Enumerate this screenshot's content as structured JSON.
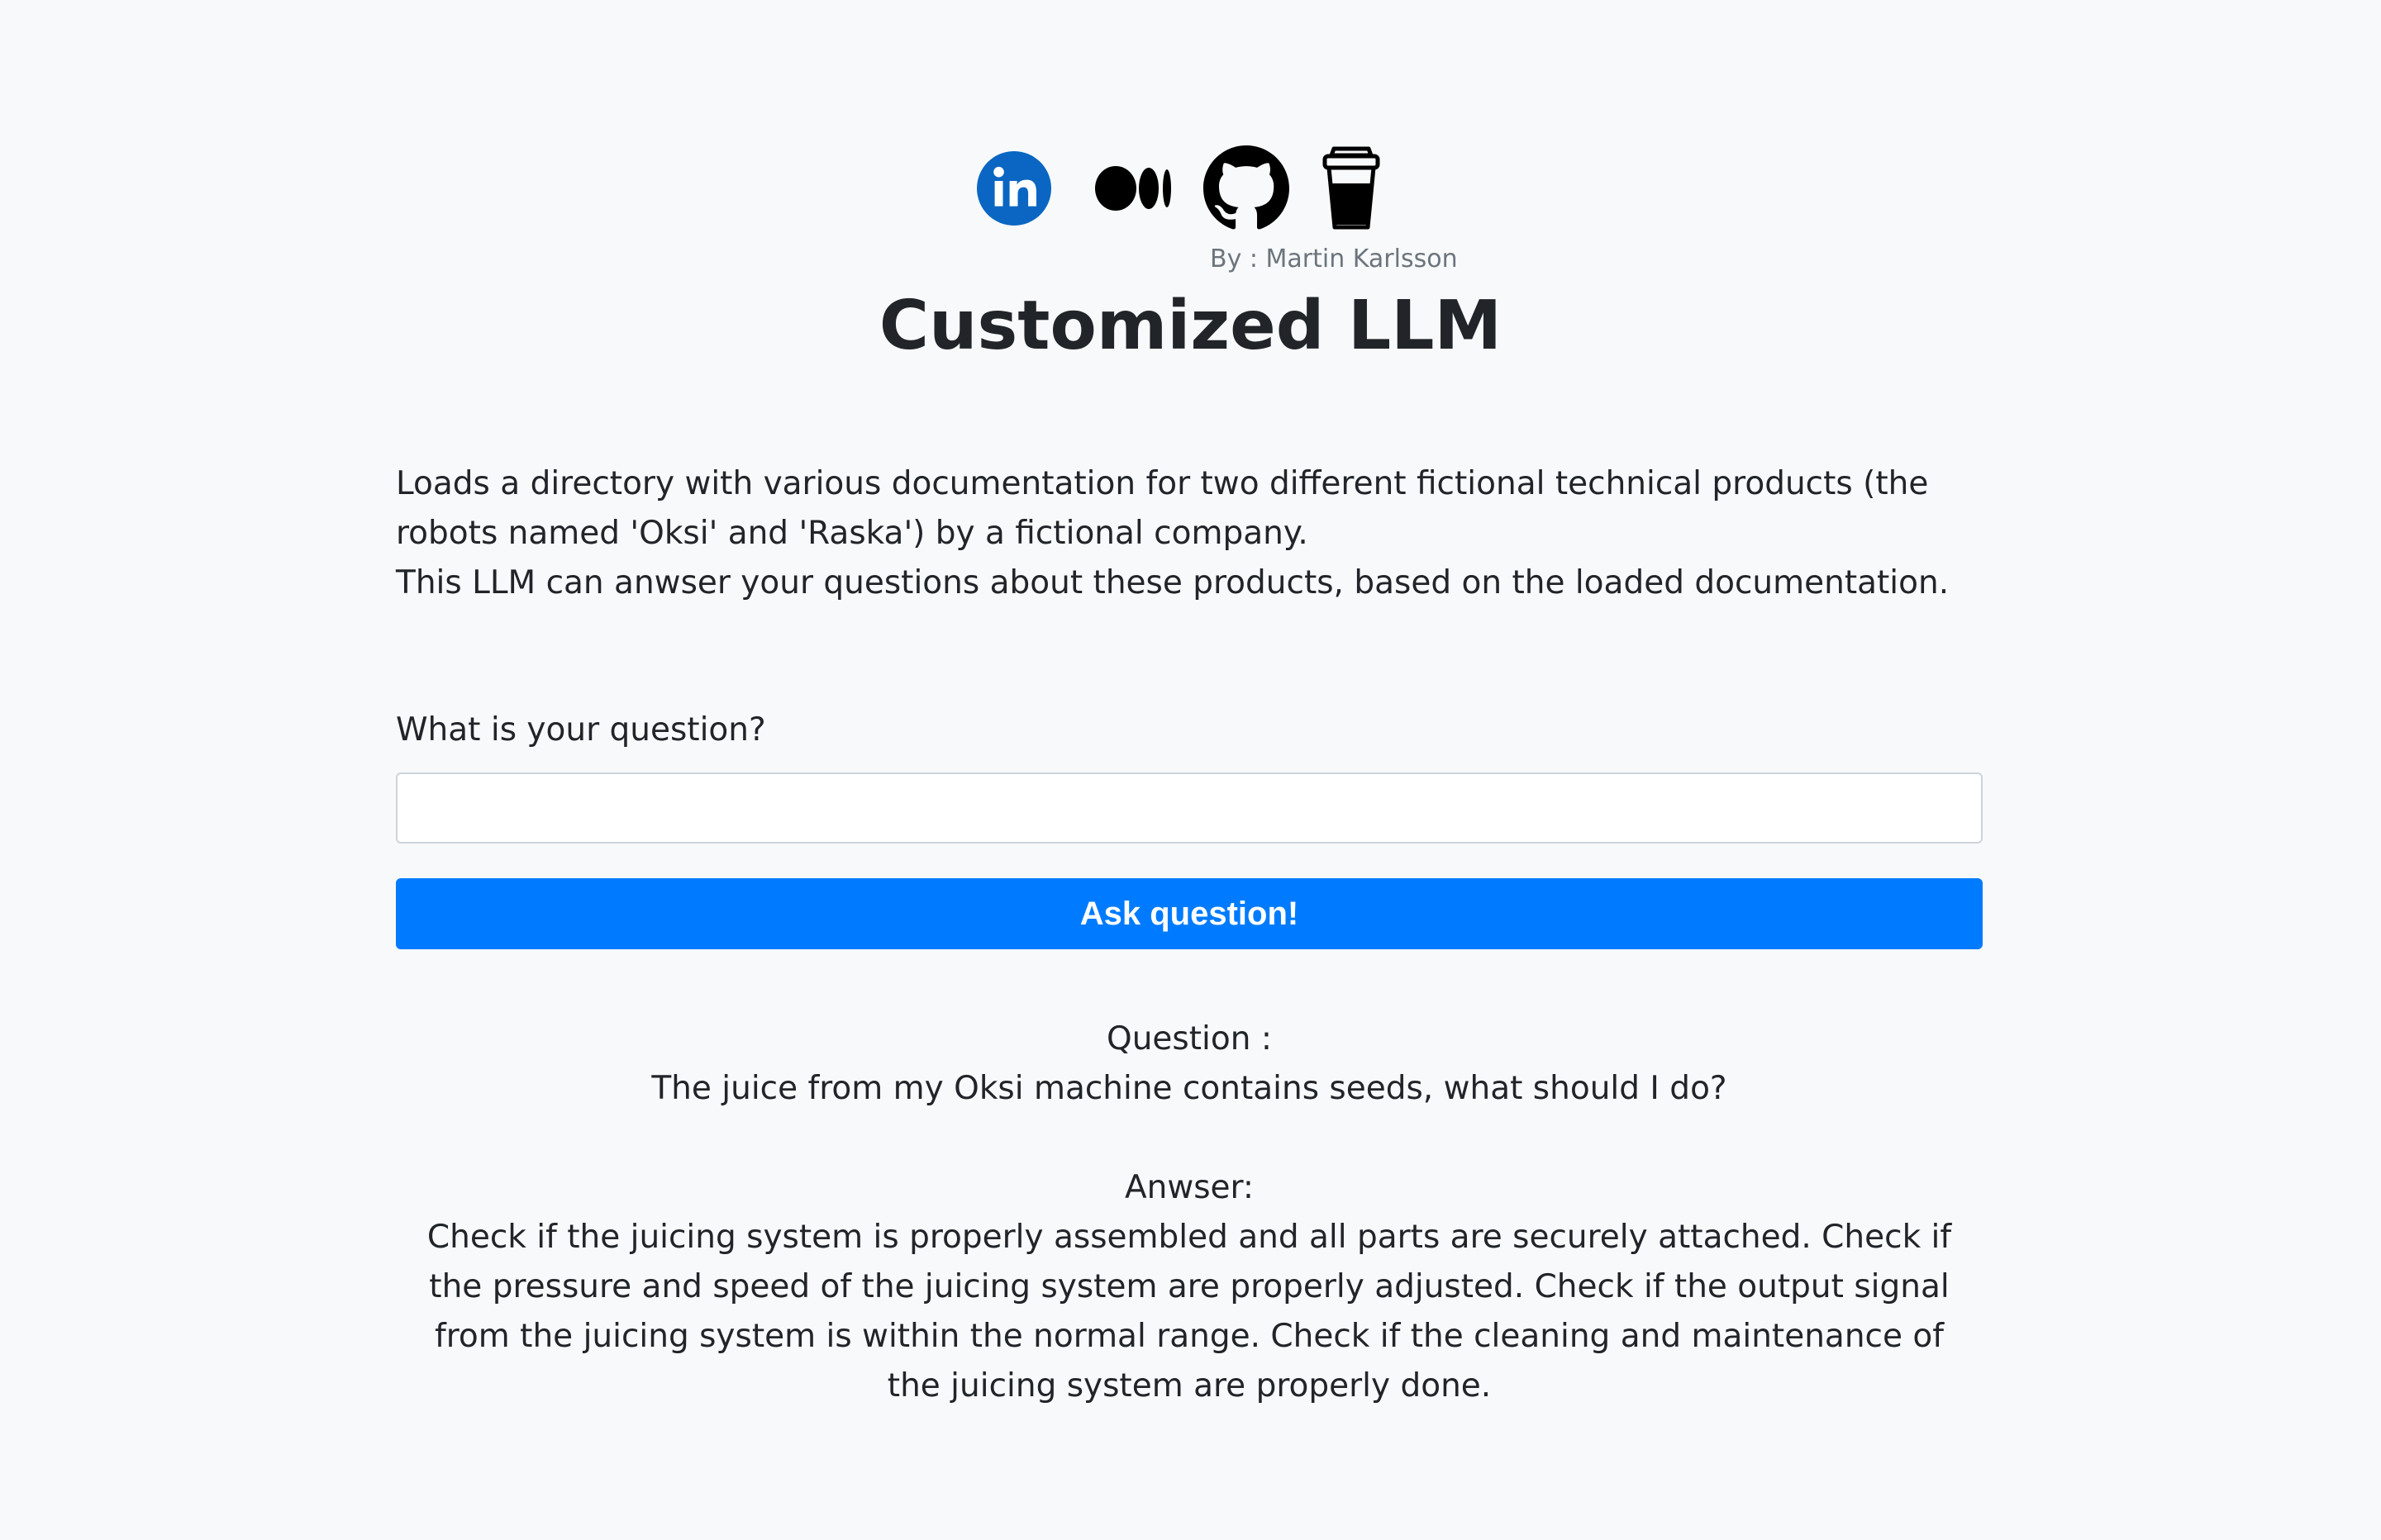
{
  "header": {
    "social_links": [
      {
        "name": "linkedin",
        "icon": "linkedin-icon",
        "color": "#0a66c2"
      },
      {
        "name": "medium",
        "icon": "medium-icon",
        "color": "#000000"
      },
      {
        "name": "github",
        "icon": "github-icon",
        "color": "#000000"
      },
      {
        "name": "buy-me-a-coffee",
        "icon": "coffee-cup-icon",
        "color": "#000000"
      }
    ],
    "byline": "By : Martin Karlsson",
    "title": "Customized LLM"
  },
  "description": {
    "line1": "Loads a directory with various documentation for two different fictional technical products (the",
    "line2": "robots named 'Oksi' and 'Raska') by a fictional company.",
    "line3": "This LLM can anwser your questions about these products, based on the loaded documentation."
  },
  "form": {
    "question_label": "What is your question?",
    "question_value": "",
    "question_placeholder": "",
    "submit_label": "Ask question!"
  },
  "result": {
    "question_heading": "Question :",
    "question_text": "The juice from my Oksi machine contains seeds, what should I do?",
    "answer_heading": "Anwser:",
    "answer_text": "Check if the juicing system is properly assembled and all parts are securely attached. Check if the pressure and speed of the juicing system are properly adjusted. Check if the output signal from the juicing system is within the normal range. Check if the cleaning and maintenance of the juicing system are properly done."
  },
  "colors": {
    "background": "#f8f9fa",
    "primary_button": "#007bff",
    "text": "#212529",
    "muted": "#6c757d"
  }
}
